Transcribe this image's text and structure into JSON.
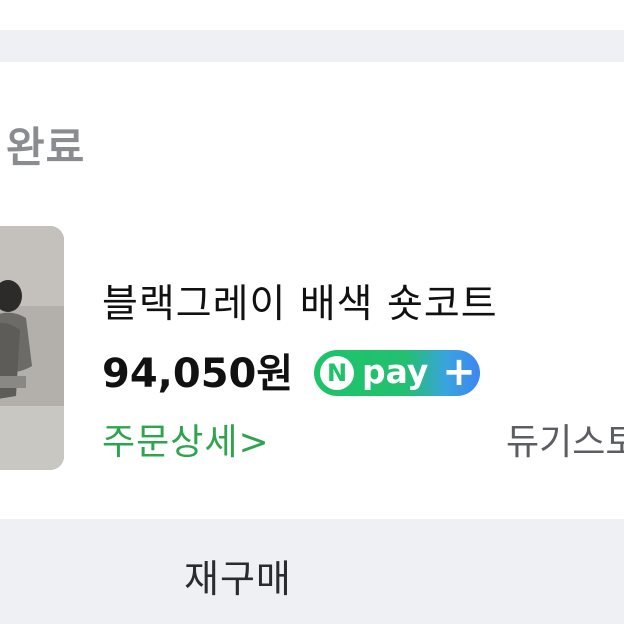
{
  "order": {
    "status": "완료",
    "product_title": "블랙그레이 배색 숏코트",
    "price": "94,050원",
    "order_detail": "주문상세>",
    "seller": "듀기스토"
  },
  "npay_badge": {
    "n_letter": "N",
    "pay_text": "pay",
    "plus_symbol": "+"
  },
  "actions": {
    "rebuy_label": "재구매"
  },
  "colors": {
    "background": "#eef0f3",
    "status_text": "#8a8c91",
    "order_detail": "#2fa44f",
    "npay_green": "#1ec36a",
    "npay_blue": "#3d86f0"
  }
}
